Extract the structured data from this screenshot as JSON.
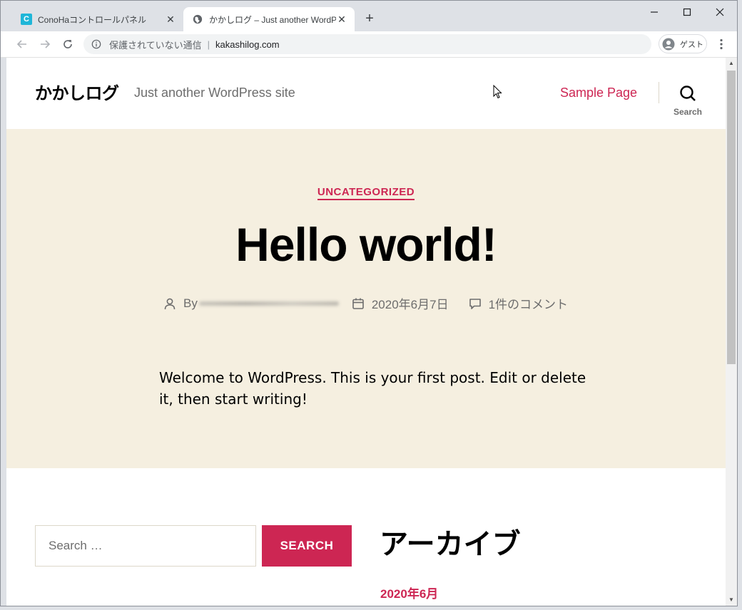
{
  "browser": {
    "tabs": [
      {
        "title": "ConoHaコントロールパネル",
        "icon": "conoha-favicon",
        "favicon_letter": "C",
        "active": false
      },
      {
        "title": "かかしログ – Just another WordPress site",
        "icon": "globe-icon",
        "active": true
      }
    ],
    "new_tab": "+",
    "close_glyph": "✕",
    "security_text": "保護されていない通信",
    "url": "kakashilog.com",
    "profile_label": "ゲスト"
  },
  "site": {
    "title": "かかしログ",
    "description": "Just another WordPress site",
    "nav": [
      {
        "label": "Sample Page"
      }
    ],
    "search_toggle_label": "Search"
  },
  "post": {
    "category": "UNCATEGORIZED",
    "title": "Hello world!",
    "by_label": "By",
    "date": "2020年6月7日",
    "comments": "1件のコメント",
    "content": "Welcome to WordPress. This is your first post. Edit or delete it, then start writing!"
  },
  "widgets": {
    "search_placeholder": "Search …",
    "search_button": "SEARCH",
    "archive_title": "アーカイブ",
    "archive_items": [
      "2020年6月"
    ]
  },
  "colors": {
    "accent": "#cd2653",
    "hero_bg": "#f5efe0",
    "secondary_text": "#6d6d6d"
  }
}
